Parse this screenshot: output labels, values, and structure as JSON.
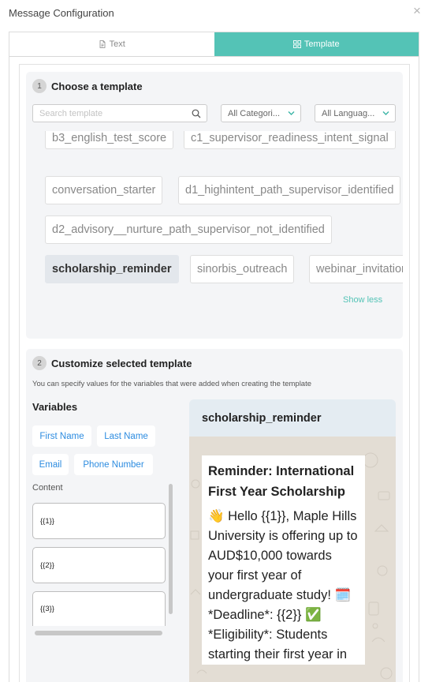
{
  "dialog": {
    "title": "Message Configuration",
    "close": "×"
  },
  "tabs": [
    {
      "label": "Text",
      "icon": "document-icon",
      "active": false
    },
    {
      "label": "Template",
      "icon": "grid-icon",
      "active": true
    }
  ],
  "step1": {
    "number": "1",
    "title": "Choose a template",
    "search_placeholder": "Search template",
    "category_filter": "All Categori...",
    "language_filter": "All Languag...",
    "templates": [
      "b3_english_test_score",
      "c1_supervisor_readiness_intent_signal",
      "conversation_starter",
      "d1_highintent_path_supervisor_identified",
      "d2_advisory__nurture_path_supervisor_not_identified",
      "scholarship_reminder",
      "sinorbis_outreach",
      "webinar_invitation"
    ],
    "selected_template": "scholarship_reminder",
    "show_less": "Show less"
  },
  "step2": {
    "number": "2",
    "title": "Customize selected template",
    "description": "You can specify values for the variables that were added when creating the template",
    "variables_heading": "Variables",
    "variable_chips": [
      "First Name",
      "Last Name",
      "Email",
      "Phone Number"
    ],
    "content_label": "Content",
    "content_fields": [
      "{{1}}",
      "{{2}}",
      "{{3}}"
    ]
  },
  "preview": {
    "template_name": "scholarship_reminder",
    "message_title": "Reminder: International First Year Scholarship",
    "message_body": "👋 Hello {{1}}, Maple Hills University is offering up to AUD$10,000 towards your first year of undergraduate study! 🗓️\n*Deadline*: {{2}} ✅\n*Eligibility*: Students starting their first year in"
  },
  "colors": {
    "accent": "#54c3b6",
    "link": "#2d8ce0",
    "section_bg": "#f4f5f7",
    "preview_header": "#e4ecf2",
    "preview_wallpaper": "#e3ddd4"
  }
}
